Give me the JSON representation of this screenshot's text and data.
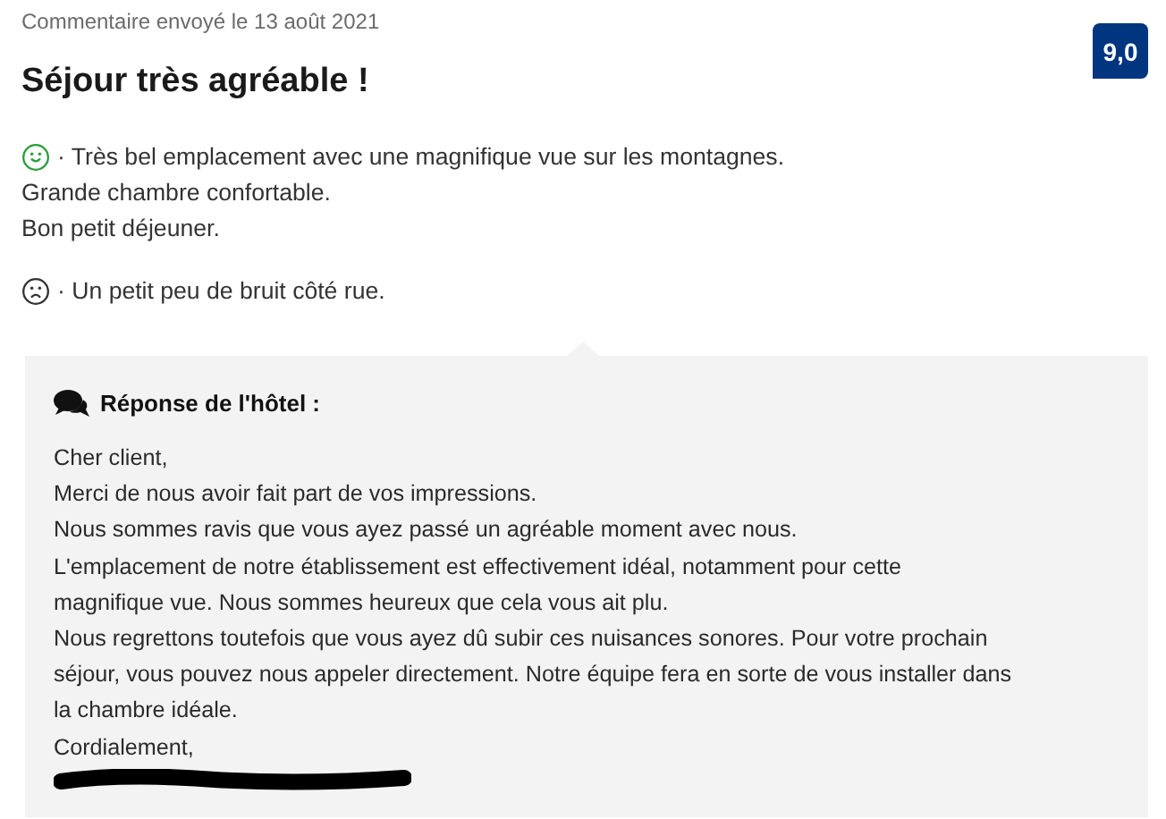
{
  "review": {
    "date": "Commentaire envoyé le 13 août 2021",
    "title": "Séjour très agréable !",
    "score": "9,0"
  },
  "comments": [
    {
      "kind": "positive",
      "lines": [
        "· Très bel emplacement avec une magnifique vue sur les montagnes.",
        "Grande chambre confortable.",
        "Bon petit déjeuner."
      ]
    },
    {
      "kind": "negative",
      "lines": [
        "· Un petit peu de bruit côté rue."
      ]
    }
  ],
  "response": {
    "heading": "Réponse de l'hôtel :",
    "lines": [
      "Cher client,",
      "Merci de nous avoir fait part de vos impressions.",
      "Nous sommes ravis que vous ayez passé un agréable moment avec nous.",
      "L'emplacement de notre établissement est effectivement idéal, notamment pour cette",
      "magnifique vue. Nous sommes heureux que cela vous ait plu.",
      "Nous regrettons toutefois que vous ayez dû subir ces nuisances sonores. Pour votre prochain",
      "séjour, vous pouvez nous appeler directement. Notre équipe fera en sorte de vous installer dans",
      "la chambre idéale.",
      "Cordialement,"
    ]
  }
}
